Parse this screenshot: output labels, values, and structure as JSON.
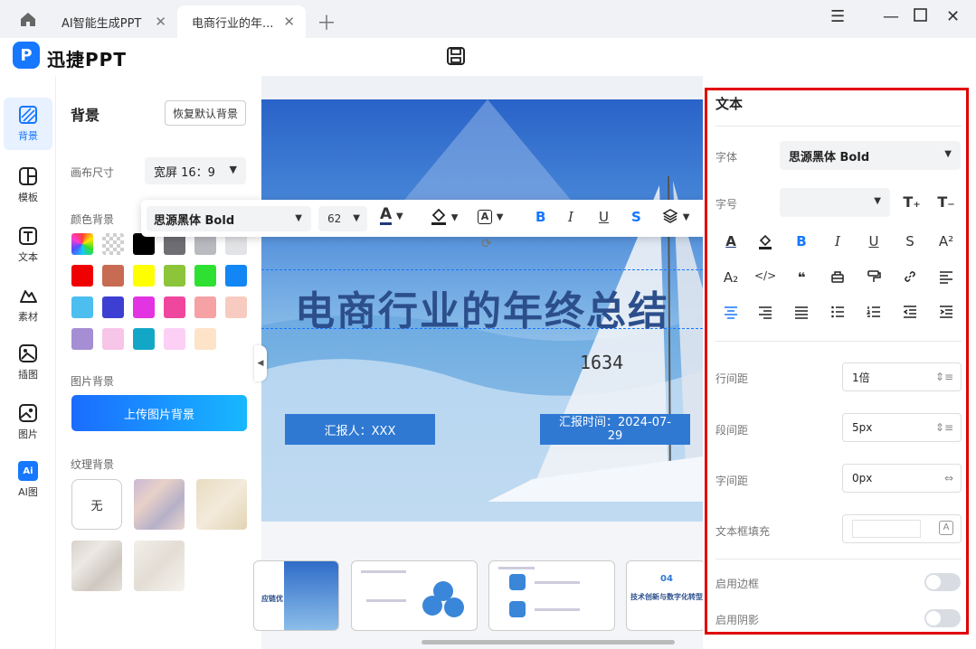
{
  "window": {
    "tabs": [
      {
        "label": "AI智能生成PPT"
      },
      {
        "label": "电商行业的年..."
      }
    ]
  },
  "app": {
    "brand": "迅捷PPT",
    "logo_letter": "P"
  },
  "rail": {
    "items": [
      {
        "label": "背景",
        "icon": "background-icon"
      },
      {
        "label": "模板",
        "icon": "template-icon"
      },
      {
        "label": "文本",
        "icon": "text-icon"
      },
      {
        "label": "素材",
        "icon": "material-icon"
      },
      {
        "label": "插图",
        "icon": "illustration-icon"
      },
      {
        "label": "图片",
        "icon": "image-icon"
      },
      {
        "label": "AI图",
        "icon": "ai-image-icon",
        "badge": "Ai"
      }
    ]
  },
  "bg_panel": {
    "title": "背景",
    "reset_label": "恢复默认背景",
    "canvas_size_label": "画布尺寸",
    "canvas_size_value": "宽屏 16：9",
    "color_bg_label": "颜色背景",
    "colors": [
      "gradient",
      "transparent",
      "#000000",
      "#6e6e73",
      "#b9bbc0",
      "#e2e3e6",
      "#f00000",
      "#c76b53",
      "#ffff00",
      "#8cc43a",
      "#2ee032",
      "#1286f5",
      "#4cbef0",
      "#3d3fd2",
      "#e334e3",
      "#f0479e",
      "#f6a1a4",
      "#f8cbc0",
      "#a58ed3",
      "#f7c5e8",
      "#13a7c7",
      "#fccff5",
      "#fde3c8"
    ],
    "image_bg_label": "图片背景",
    "upload_label": "上传图片背景",
    "texture_bg_label": "纹理背景",
    "texture_none": "无"
  },
  "slide": {
    "title": "电商行业的年终总结",
    "reporter": "汇报人：XXX",
    "report_time": "汇报时间：2024-07-29",
    "sail_number": "1634"
  },
  "toolbar": {
    "font": "思源黑体 Bold",
    "size": "62"
  },
  "thumbnails": [
    {
      "caption": "应链优"
    },
    {
      "caption": ""
    },
    {
      "caption": ""
    },
    {
      "number": "04",
      "caption": "技术创新与数字化转型"
    }
  ],
  "right_panel": {
    "title": "文本",
    "font_label": "字体",
    "font_value": "思源黑体 Bold",
    "size_label": "字号",
    "line_spacing_label": "行间距",
    "line_spacing_value": "1倍",
    "para_spacing_label": "段间距",
    "para_spacing_value": "5px",
    "char_spacing_label": "字间距",
    "char_spacing_value": "0px",
    "fill_label": "文本框填充",
    "border_label": "启用边框",
    "shadow_label": "启用阴影",
    "border_enabled": false,
    "shadow_enabled": false
  }
}
